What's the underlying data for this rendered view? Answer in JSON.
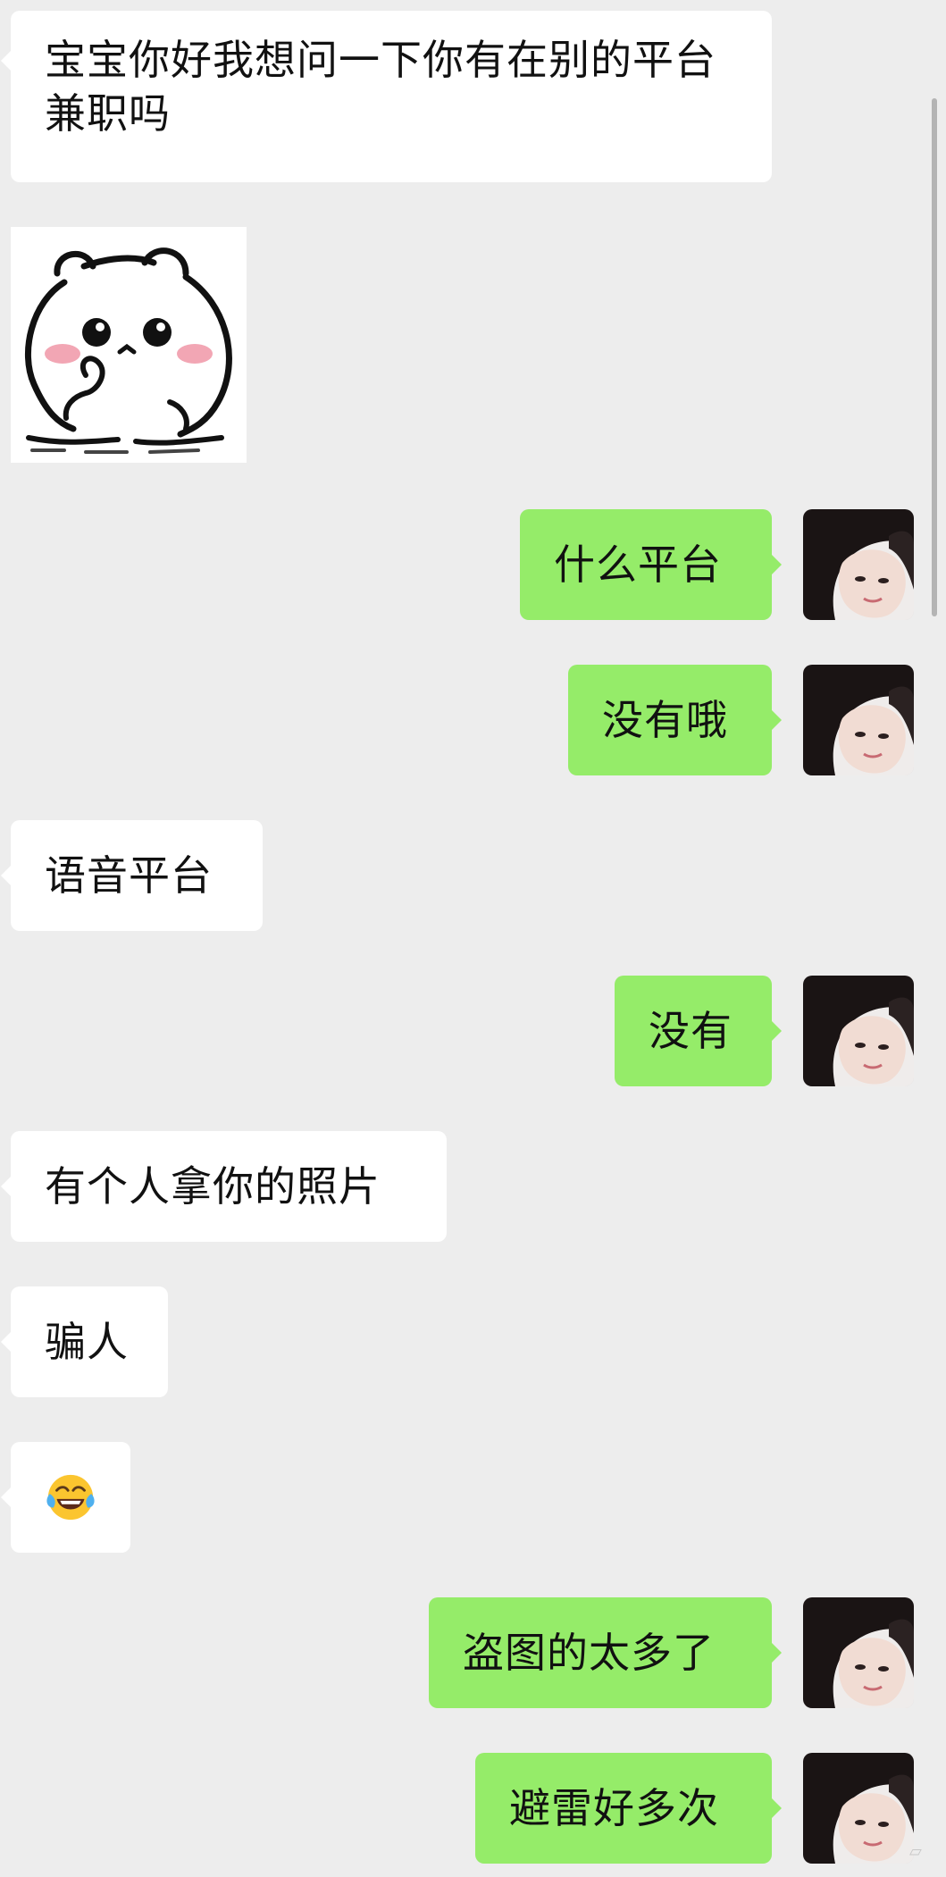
{
  "messages": [
    {
      "side": "left",
      "type": "text",
      "text": "宝宝你好我想问一下你有在别的平台兼职吗"
    },
    {
      "side": "left",
      "type": "sticker",
      "sticker": "white-hamster-sticker"
    },
    {
      "side": "right",
      "type": "text",
      "text": "什么平台"
    },
    {
      "side": "right",
      "type": "text",
      "text": "没有哦"
    },
    {
      "side": "left",
      "type": "text",
      "text": "语音平台"
    },
    {
      "side": "right",
      "type": "text",
      "text": "没有"
    },
    {
      "side": "left",
      "type": "text",
      "text": "有个人拿你的照片"
    },
    {
      "side": "left",
      "type": "text",
      "text": "骗人"
    },
    {
      "side": "left",
      "type": "emoji",
      "emoji": "face-with-tears-of-joy"
    },
    {
      "side": "right",
      "type": "text",
      "text": "盗图的太多了"
    },
    {
      "side": "right",
      "type": "text",
      "text": "避雷好多次"
    }
  ],
  "colors": {
    "background": "#ededed",
    "incoming_bubble": "#ffffff",
    "outgoing_bubble": "#95ec69",
    "text": "#111111"
  },
  "icons": {
    "avatar": "user-avatar-photo",
    "corner": "watermark-icon"
  }
}
